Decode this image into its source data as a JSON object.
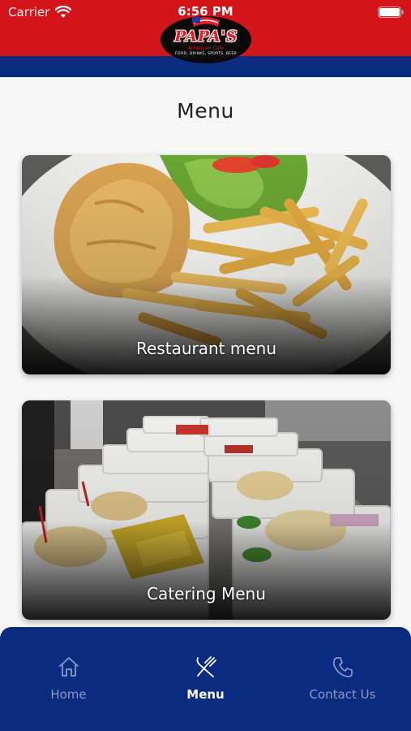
{
  "status_bar": {
    "carrier": "Carrier",
    "time": "6:56 PM",
    "icons": [
      "wifi-icon",
      "battery-icon"
    ]
  },
  "header": {
    "logo_text": "PAPA'S",
    "logo_subtitle": "American Cafe",
    "logo_tagline": "FOOD, DRINKS, SPORTS, BEER",
    "colors": {
      "red": "#d3151b",
      "blue": "#0b2b80"
    }
  },
  "page": {
    "title": "Menu"
  },
  "cards": [
    {
      "label": "Restaurant menu",
      "image": "fried-fish-and-fries-photo"
    },
    {
      "label": "Catering Menu",
      "image": "catering-trays-photo"
    }
  ],
  "tab_bar": {
    "active": "Menu",
    "tabs": [
      {
        "label": "Home",
        "icon": "home-icon"
      },
      {
        "label": "Menu",
        "icon": "utensils-icon"
      },
      {
        "label": "Contact Us",
        "icon": "phone-icon"
      }
    ]
  }
}
